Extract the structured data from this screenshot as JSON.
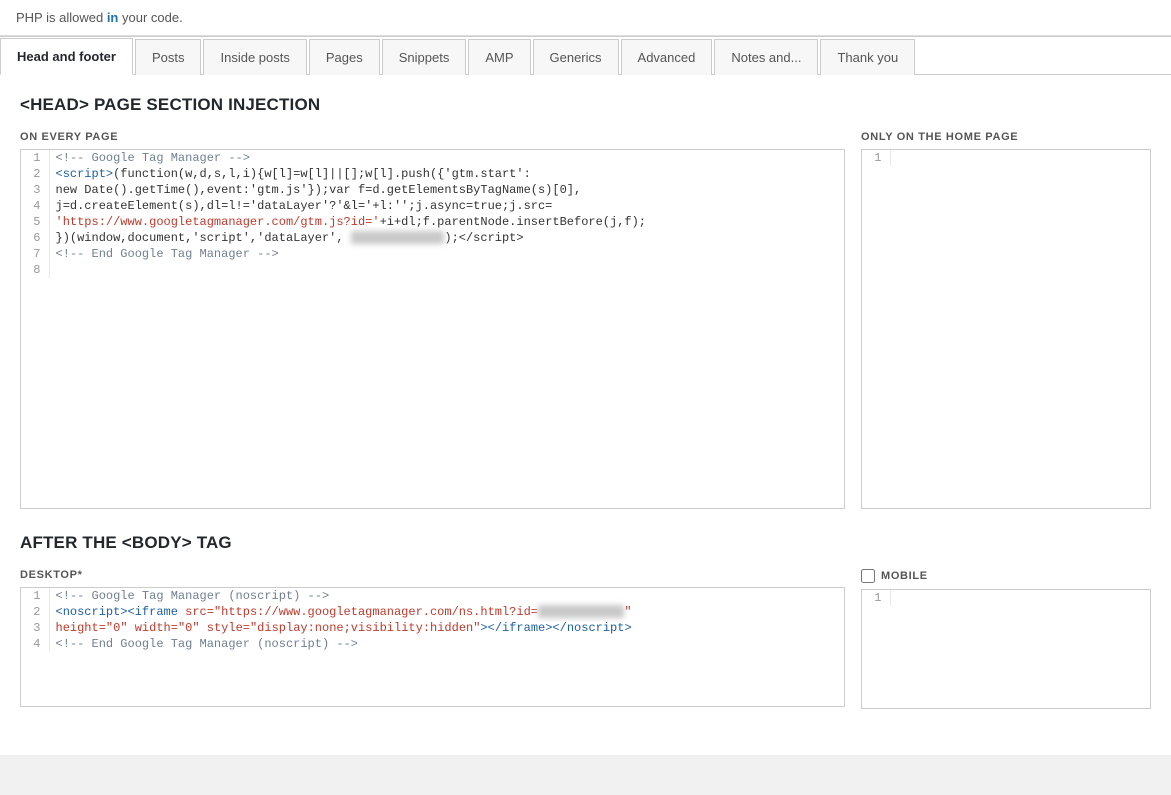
{
  "topNotice": {
    "text": "PHP is allowed in your code."
  },
  "tabs": [
    {
      "id": "head-footer",
      "label": "Head and footer",
      "active": true
    },
    {
      "id": "posts",
      "label": "Posts",
      "active": false
    },
    {
      "id": "inside-posts",
      "label": "Inside posts",
      "active": false
    },
    {
      "id": "pages",
      "label": "Pages",
      "active": false
    },
    {
      "id": "snippets",
      "label": "Snippets",
      "active": false
    },
    {
      "id": "amp",
      "label": "AMP",
      "active": false
    },
    {
      "id": "generics",
      "label": "Generics",
      "active": false
    },
    {
      "id": "advanced",
      "label": "Advanced",
      "active": false
    },
    {
      "id": "notes-and",
      "label": "Notes and...",
      "active": false
    },
    {
      "id": "thank-you",
      "label": "Thank you",
      "active": false
    }
  ],
  "headSection": {
    "title": "<HEAD> PAGE SECTION INJECTION",
    "leftLabel": "ON EVERY PAGE",
    "rightLabel": "ONLY ON THE HOME PAGE"
  },
  "bodySection": {
    "title": "AFTER THE <BODY> TAG",
    "leftLabel": "DESKTOP*",
    "rightLabel": "MOBILE"
  }
}
